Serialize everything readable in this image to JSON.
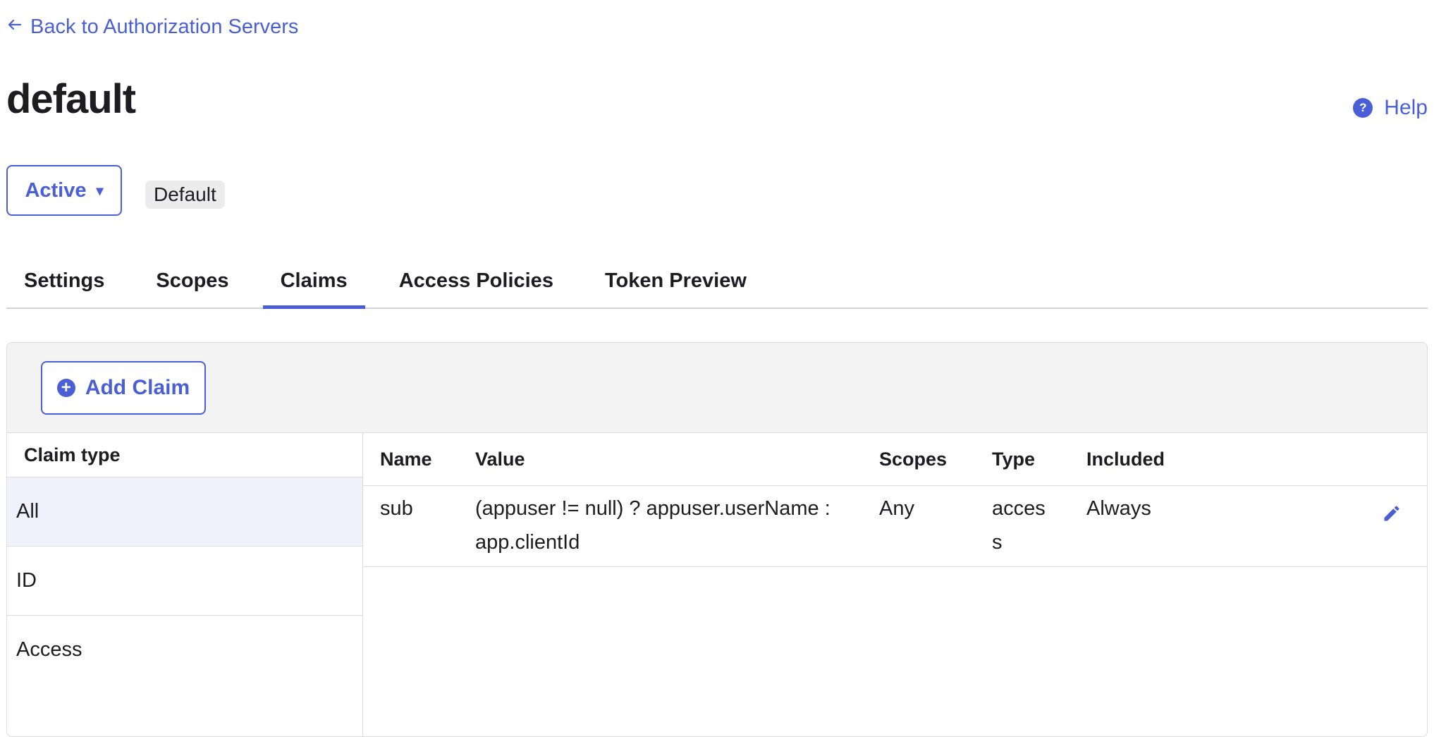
{
  "nav": {
    "back_label": "Back to Authorization Servers"
  },
  "header": {
    "title": "default",
    "help_label": "Help",
    "help_glyph": "?",
    "status_label": "Active",
    "status_caret": "▾",
    "badge_label": "Default"
  },
  "tabs": [
    {
      "label": "Settings",
      "active": false
    },
    {
      "label": "Scopes",
      "active": false
    },
    {
      "label": "Claims",
      "active": true
    },
    {
      "label": "Access Policies",
      "active": false
    },
    {
      "label": "Token Preview",
      "active": false
    }
  ],
  "toolbar": {
    "add_claim_label": "Add Claim",
    "add_claim_glyph": "+"
  },
  "claim_types": {
    "header": "Claim type",
    "items": [
      {
        "label": "All",
        "selected": true
      },
      {
        "label": "ID",
        "selected": false
      },
      {
        "label": "Access",
        "selected": false
      }
    ]
  },
  "claims_table": {
    "columns": [
      "Name",
      "Value",
      "Scopes",
      "Type",
      "Included"
    ],
    "rows": [
      {
        "name": "sub",
        "value": "(appuser != null) ? appuser.userName : app.clientId",
        "scopes": "Any",
        "type": "access",
        "included": "Always"
      }
    ]
  },
  "icons": {
    "back": "arrow-left-icon",
    "help": "question-circle-icon",
    "add": "plus-circle-icon",
    "edit": "pencil-icon"
  },
  "colors": {
    "accent": "#4a5fd6",
    "text": "#1d1d21",
    "border": "#dcdcdc",
    "toolbar_bg": "#f3f3f3",
    "selected_bg": "#f0f1fb"
  }
}
